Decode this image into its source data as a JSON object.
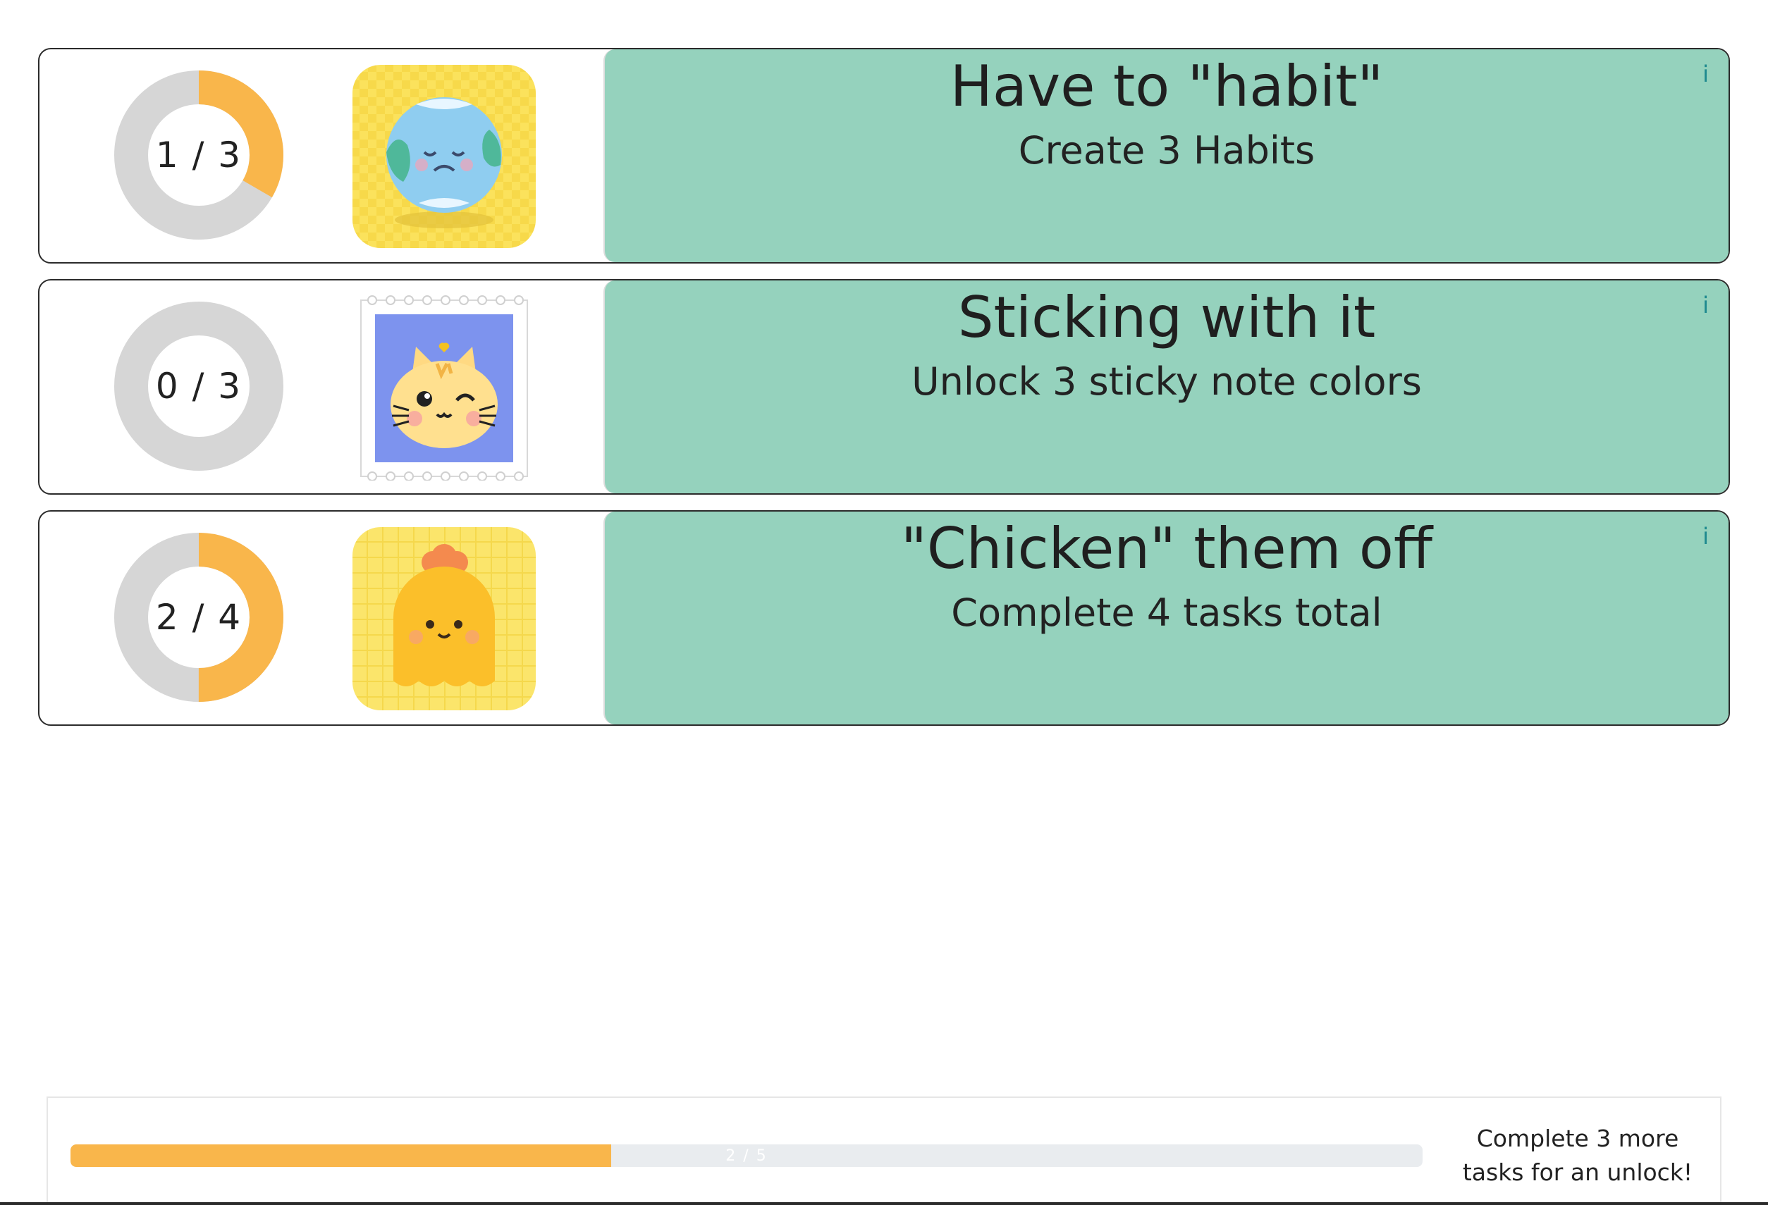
{
  "achievements": [
    {
      "title": "Have to \"habit\"",
      "description": "Create 3 Habits",
      "progress_label": "1 / 3",
      "progress_current": 1,
      "progress_total": 3,
      "badge_icon": "earth-icon",
      "info_label": "i"
    },
    {
      "title": "Sticking with it",
      "description": "Unlock 3 sticky note colors",
      "progress_label": "0 / 3",
      "progress_current": 0,
      "progress_total": 3,
      "badge_icon": "cat-stamp-icon",
      "info_label": "i"
    },
    {
      "title": "\"Chicken\" them off",
      "description": "Complete 4 tasks total",
      "progress_label": "2 / 4",
      "progress_current": 2,
      "progress_total": 4,
      "badge_icon": "chicken-icon",
      "info_label": "i"
    }
  ],
  "unlock_progress": {
    "label": "2 / 5",
    "current": 2,
    "total": 5,
    "message": "Complete 3 more tasks for an unlock!"
  },
  "colors": {
    "accent_orange": "#f9b64b",
    "panel_green": "#95d2bd",
    "ring_track": "#d6d6d6",
    "info_teal": "#1e8a8f"
  }
}
